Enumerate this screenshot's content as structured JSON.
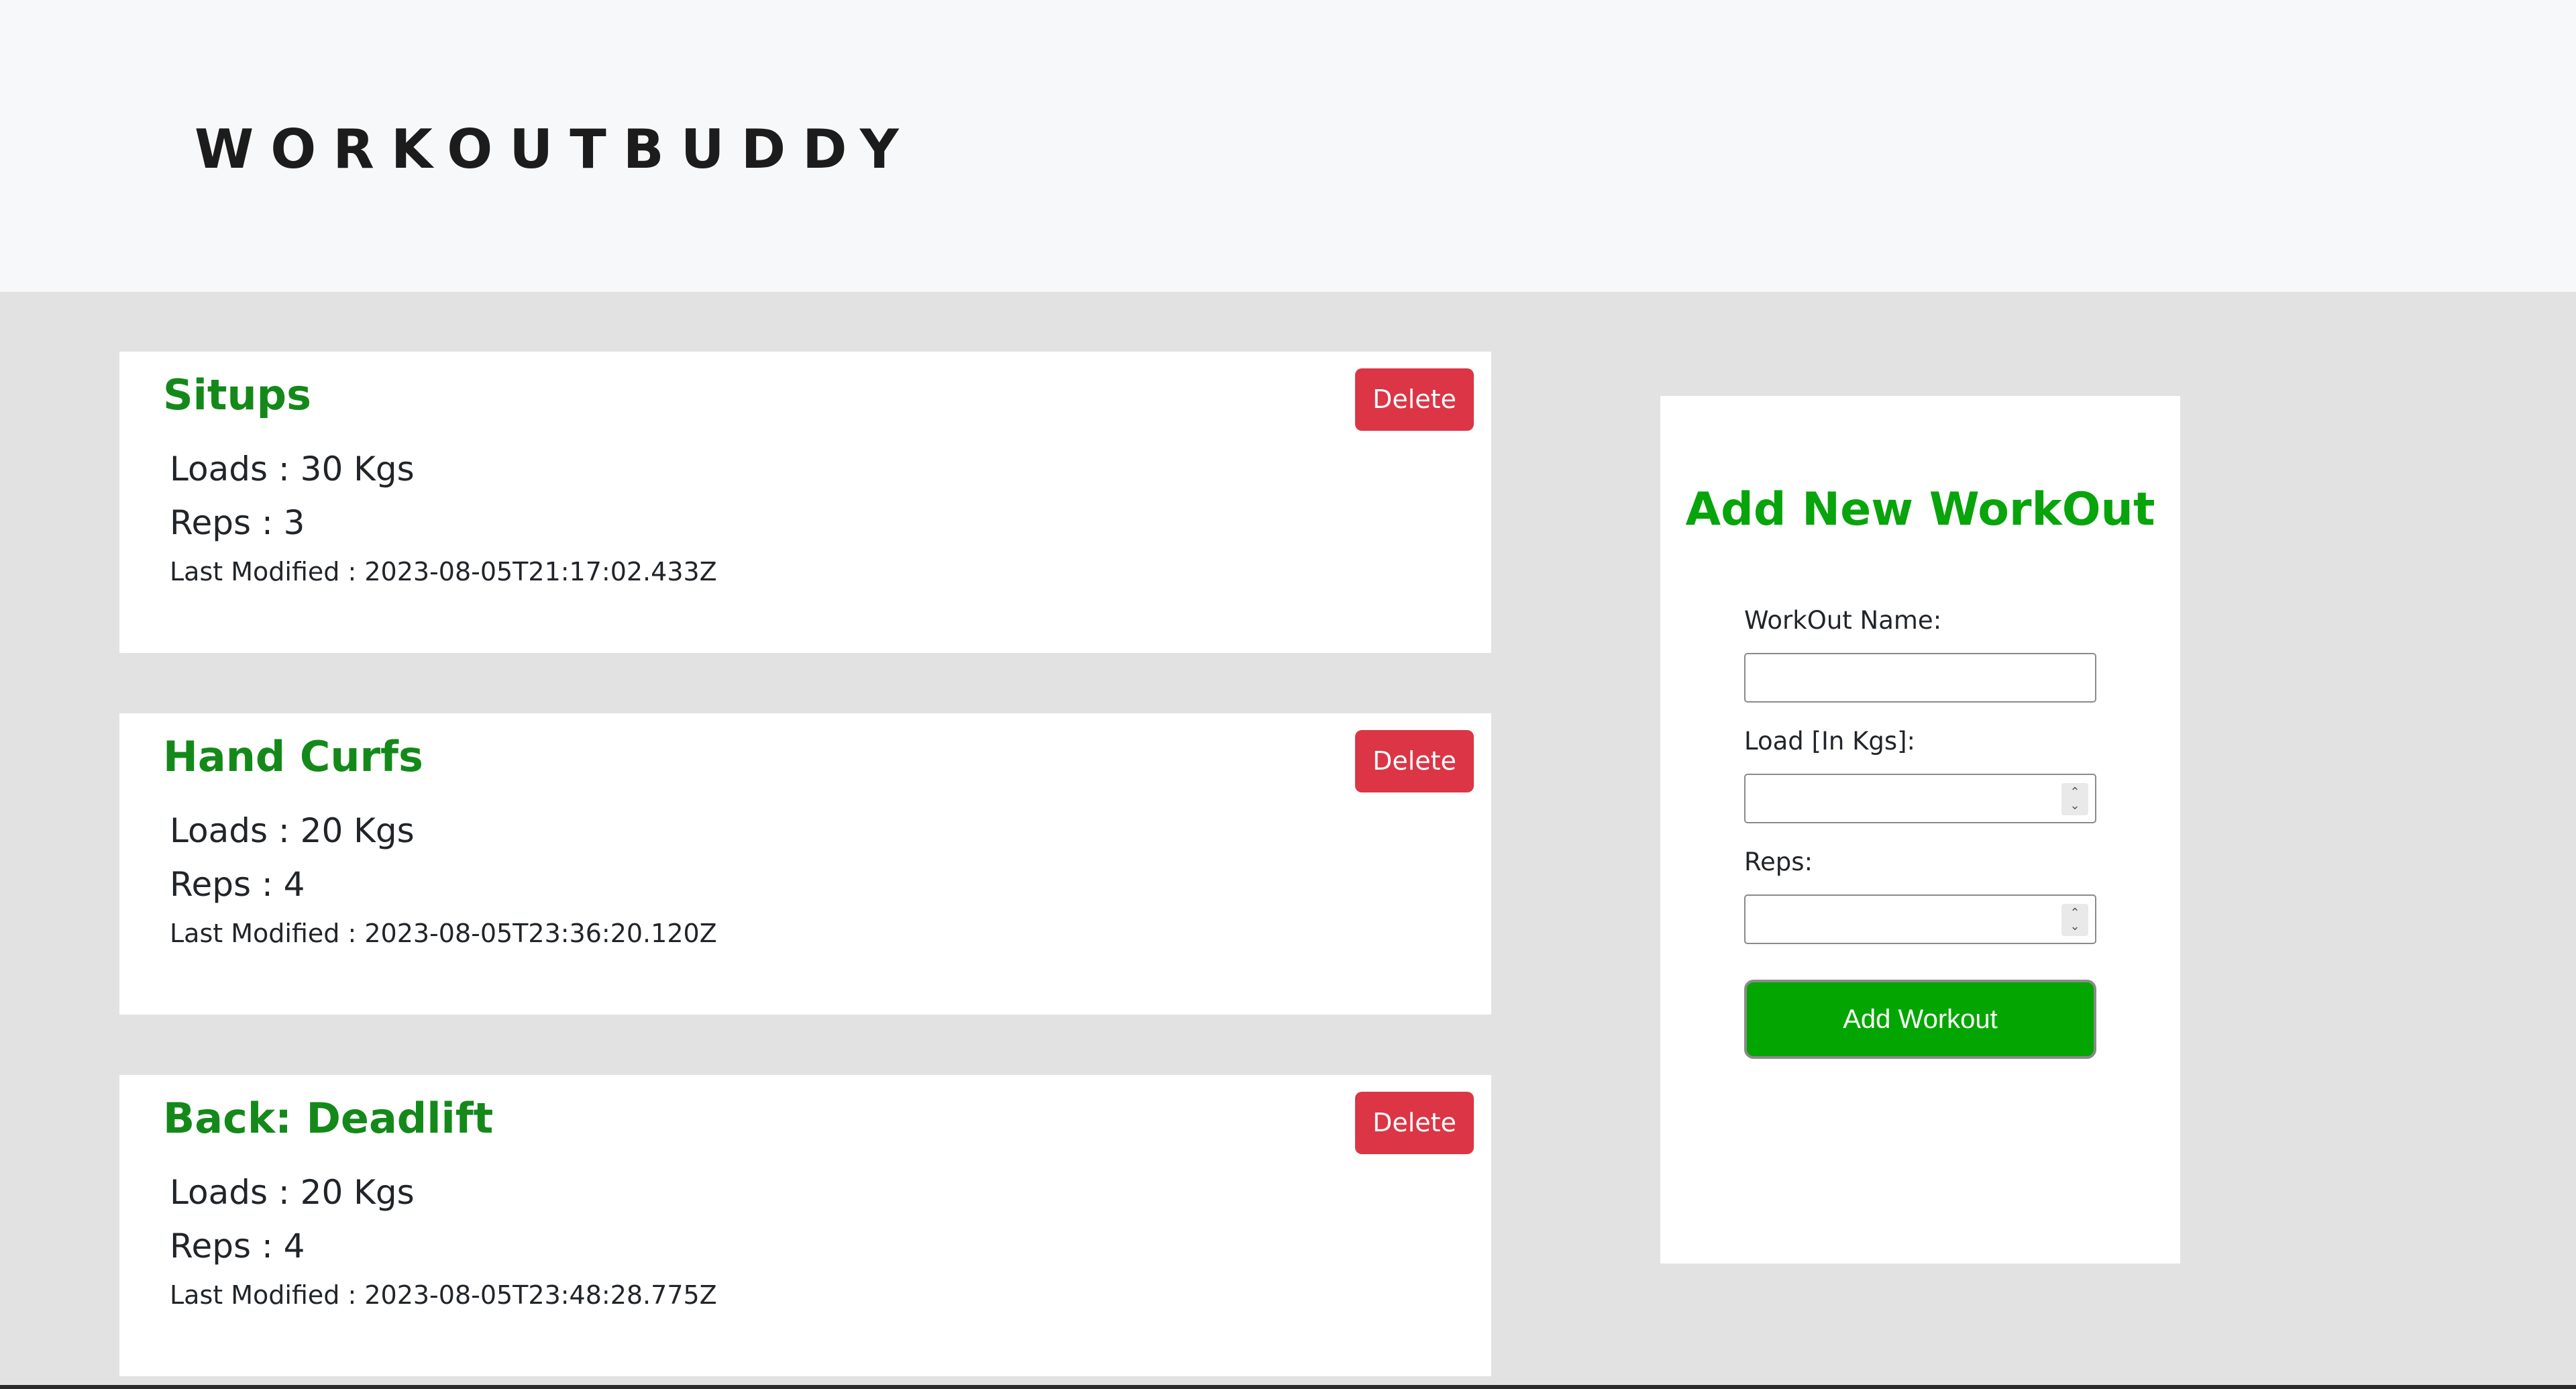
{
  "header": {
    "brand": "WORKOUTBUDDY"
  },
  "workouts": [
    {
      "title": "Situps",
      "loads": "Loads : 30 Kgs",
      "reps": "Reps : 3",
      "modified": "Last Modified : 2023-08-05T21:17:02.433Z",
      "delete_label": "Delete"
    },
    {
      "title": "Hand Curfs",
      "loads": "Loads : 20 Kgs",
      "reps": "Reps : 4",
      "modified": "Last Modified : 2023-08-05T23:36:20.120Z",
      "delete_label": "Delete"
    },
    {
      "title": "Back: Deadlift",
      "loads": "Loads : 20 Kgs",
      "reps": "Reps : 4",
      "modified": "Last Modified : 2023-08-05T23:48:28.775Z",
      "delete_label": "Delete"
    }
  ],
  "form": {
    "title": "Add New WorkOut",
    "name_label": "WorkOut Name:",
    "name_value": "",
    "load_label": "Load [In Kgs]:",
    "load_value": "",
    "reps_label": "Reps:",
    "reps_value": "",
    "submit_label": "Add Workout"
  },
  "colors": {
    "title_green": "#14891a",
    "form_title_green": "#07a40b",
    "add_button_green": "#03a600",
    "delete_red": "#dc3545",
    "background": "#e2e2e2",
    "navbar": "#f7f8fa"
  }
}
